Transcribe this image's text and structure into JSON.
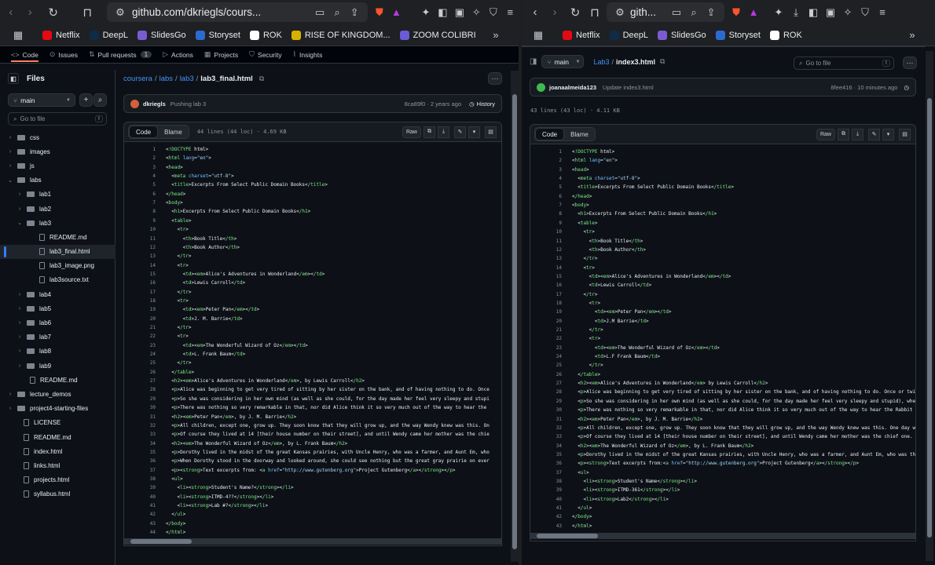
{
  "left": {
    "url": "github.com/dkriegls/cours...",
    "bookmarks": [
      {
        "label": "Netflix",
        "color": "#e50914"
      },
      {
        "label": "DeepL",
        "color": "#0f2b46"
      },
      {
        "label": "SlidesGo",
        "color": "#7a5cd0"
      },
      {
        "label": "Storyset",
        "color": "#2a6bd1"
      },
      {
        "label": "ROK",
        "color": "#ffffff"
      },
      {
        "label": "RISE OF KINGDOM...",
        "color": "#d8b100"
      },
      {
        "label": "ZOOM COLIBRI",
        "color": "#6b5bd6"
      }
    ],
    "repo_tabs": [
      {
        "label": "Code",
        "icon": "<>"
      },
      {
        "label": "Issues",
        "icon": "⊙"
      },
      {
        "label": "Pull requests",
        "icon": "⇅",
        "count": "1"
      },
      {
        "label": "Actions",
        "icon": "▷"
      },
      {
        "label": "Projects",
        "icon": "▦"
      },
      {
        "label": "Security",
        "icon": "⛉"
      },
      {
        "label": "Insights",
        "icon": "⌇"
      }
    ],
    "files_title": "Files",
    "branch": "main",
    "goto_placeholder": "Go to file",
    "goto_key": "t",
    "tree": [
      {
        "label": "css",
        "type": "folder",
        "depth": 0
      },
      {
        "label": "images",
        "type": "folder",
        "depth": 0
      },
      {
        "label": "js",
        "type": "folder",
        "depth": 0
      },
      {
        "label": "labs",
        "type": "folder-open",
        "depth": 0
      },
      {
        "label": "lab1",
        "type": "folder",
        "depth": 1
      },
      {
        "label": "lab2",
        "type": "folder",
        "depth": 1
      },
      {
        "label": "lab3",
        "type": "folder-open",
        "depth": 1
      },
      {
        "label": "README.md",
        "type": "file",
        "depth": 2
      },
      {
        "label": "lab3_final.html",
        "type": "file",
        "depth": 2,
        "selected": true
      },
      {
        "label": "lab3_image.png",
        "type": "file",
        "depth": 2
      },
      {
        "label": "lab3source.txt",
        "type": "file",
        "depth": 2
      },
      {
        "label": "lab4",
        "type": "folder",
        "depth": 1
      },
      {
        "label": "lab5",
        "type": "folder",
        "depth": 1
      },
      {
        "label": "lab6",
        "type": "folder",
        "depth": 1
      },
      {
        "label": "lab7",
        "type": "folder",
        "depth": 1
      },
      {
        "label": "lab8",
        "type": "folder",
        "depth": 1
      },
      {
        "label": "lab9",
        "type": "folder",
        "depth": 1
      },
      {
        "label": "README.md",
        "type": "file",
        "depth": 1
      },
      {
        "label": "lecture_demos",
        "type": "folder",
        "depth": 0
      },
      {
        "label": "project4-starting-files",
        "type": "folder",
        "depth": 0
      },
      {
        "label": "LICENSE",
        "type": "file",
        "depth": 0
      },
      {
        "label": "README.md",
        "type": "file",
        "depth": 0
      },
      {
        "label": "index.html",
        "type": "file",
        "depth": 0
      },
      {
        "label": "links.html",
        "type": "file",
        "depth": 0
      },
      {
        "label": "projects.html",
        "type": "file",
        "depth": 0
      },
      {
        "label": "syllabus.html",
        "type": "file",
        "depth": 0
      }
    ],
    "breadcrumb": [
      "coursera",
      "labs",
      "lab3"
    ],
    "filename": "lab3_final.html",
    "commit": {
      "author": "dkriegls",
      "message": "Pushing lab 3",
      "sha_time": "8ca89f0 · 2 years ago",
      "history": "History"
    },
    "code_tab": "Code",
    "blame_tab": "Blame",
    "meta": "44 lines (44 loc) · 4.69 KB",
    "raw": "Raw",
    "lines": [
      "<!DOCTYPE html>",
      "<html lang=\"en\">",
      "<head>",
      "  <meta charset=\"utf-8\">",
      "  <title>Excerpts From Select Public Domain Books</title>",
      "</head>",
      "<body>",
      "  <h1>Excerpts From Select Public Domain Books</h1>",
      "  <table>",
      "    <tr>",
      "      <th>Book Title</th>",
      "      <th>Book Author</th>",
      "    </tr>",
      "    <tr>",
      "      <td><em>Alice's Adventures in Wonderland</em></td>",
      "      <td>Lewis Carroll</td>",
      "    </tr>",
      "    <tr>",
      "      <td><em>Peter Pan</em></td>",
      "      <td>J. M. Barrie</td>",
      "    </tr>",
      "    <tr>",
      "      <td><em>The Wonderful Wizard of Oz</em></td>",
      "      <td>L. Frank Baum</td>",
      "    </tr>",
      "  </table>",
      "  <h2><em>Alice's Adventures in Wonderland</em>, by Lewis Carroll</h2>",
      "  <p>Alice was beginning to get very tired of sitting by her sister on the bank, and of having nothing to do. Once",
      "  <p>So she was considering in her own mind (as well as she could, for the day made her feel very sleepy and stupi",
      "  <p>There was nothing so very remarkable in that, nor did Alice think it so very much out of the way to hear the",
      "  <h2><em>Peter Pan</em>, by J. M. Barrie</h2>",
      "  <p>All children, except one, grow up. They soon know that they will grow up, and the way Wendy knew was this. On",
      "  <p>Of course they lived at 14 [their house number on their street], and until Wendy came her mother was the chie",
      "  <h2><em>The Wonderful Wizard of Oz</em>, by L. Frank Baum</h2>",
      "  <p>Dorothy lived in the midst of the great Kansas prairies, with Uncle Henry, who was a farmer, and Aunt Em, who",
      "  <p>When Dorothy stood in the doorway and looked around, she could see nothing but the great gray prairie on ever",
      "  <p><strong>Text excerpts from: <a href=\"http://www.gutenberg.org\">Project Gutenberg</a></strong></p>",
      "  <ul>",
      "    <li><strong>Student's Name?</strong></li>",
      "    <li><strong>ITMD-4??</strong></li>",
      "    <li><strong>Lab #?</strong></li>",
      "  </ul>",
      "</body>",
      "</html>"
    ]
  },
  "right": {
    "url": "gith...",
    "bookmarks": [
      {
        "label": "Netflix",
        "color": "#e50914"
      },
      {
        "label": "DeepL",
        "color": "#0f2b46"
      },
      {
        "label": "SlidesGo",
        "color": "#7a5cd0"
      },
      {
        "label": "Storyset",
        "color": "#2a6bd1"
      },
      {
        "label": "ROK",
        "color": "#ffffff"
      }
    ],
    "branch": "main",
    "breadcrumb": [
      "Lab3"
    ],
    "filename": "index3.html",
    "goto_placeholder": "Go to file",
    "goto_key": "t",
    "commit": {
      "author": "joanaalmeida123",
      "message": "Update index3.html",
      "sha_time": "8fee416 · 10 minutes ago"
    },
    "info": "43 lines (43 loc) · 4.11 KB",
    "code_tab": "Code",
    "blame_tab": "Blame",
    "raw": "Raw",
    "lines": [
      "<!DOCTYPE html>",
      "<html lang=\"en\">",
      "<head>",
      "  <meta charset=\"utf-8\">",
      "  <title>Excerpts From Select Public Domain Books</title>",
      "</head>",
      "<body>",
      "  <h1>Excerpts From Select Public Domain Books</h1>",
      "  <table>",
      "    <tr>",
      "      <th>Book Title</th>",
      "      <th>Book Author</th>",
      "    </tr>",
      "    <tr>",
      "      <td><em>Alice's Adventures in Wonderland</em></td>",
      "      <td>Lewis Carroll</td>",
      "    </tr>",
      "      <tr>",
      "        <td><em>Peter Pan</em></td>",
      "        <td>J.M Barrie</td>",
      "      </tr>",
      "      <tr>",
      "        <td><em>The Wonderful Wizard of Oz</em></td>",
      "        <td>L.F Frank Baum</td>",
      "      </tr>",
      "  </table>",
      "  <h2><em>Alice's Adventures in Wonderland</em> by Lewis Carroll</h2>",
      "  <p>Alice was beginning to get very tired of sitting by her sister on the bank, and of having nothing to do. Once or twic",
      "  <p>So she was considering in her own mind (as well as she could, for the day made her feel very sleepy and stupid), whet",
      "  <p>There was nothing so very remarkable in that, nor did Alice think it so very much out of the way to hear the Rabbit s",
      "  <h2><em>Peter Pan</em>, by J. M. Barrie</h2>",
      "  <p>All children, except one, grow up. They soon know that they will grow up, and the way Wendy knew was this. One day wh",
      "  <p>Of course they lived at 14 [their house number on their street], and until Wendy came her mother was the chief one. S",
      "  <h2><em>The Wonderful Wizard of Oz</em>, by L. Frank Baum</h2>",
      "  <p>Dorothy lived in the midst of the great Kansas prairies, with Uncle Henry, who was a farmer, and Aunt Em, who was the",
      "  <p><strong>Text excerpts from:<a href=\"http://www.gutenberg.org\">Project Gutenberg</a></strong></p>",
      "  <ul>",
      "    <li><strong>Student's Name</strong></li>",
      "    <li><strong>ITMD-361</strong></li>",
      "    <li><strong>Lab2</strong></li>",
      "  </ul>",
      "</body>",
      "</html>"
    ]
  },
  "colors": {
    "tag": "#7ee787",
    "attr": "#79c0ff",
    "string": "#a5d6ff",
    "text": "#e6edf3",
    "link": "#4493f8",
    "accent": "#f78166"
  }
}
